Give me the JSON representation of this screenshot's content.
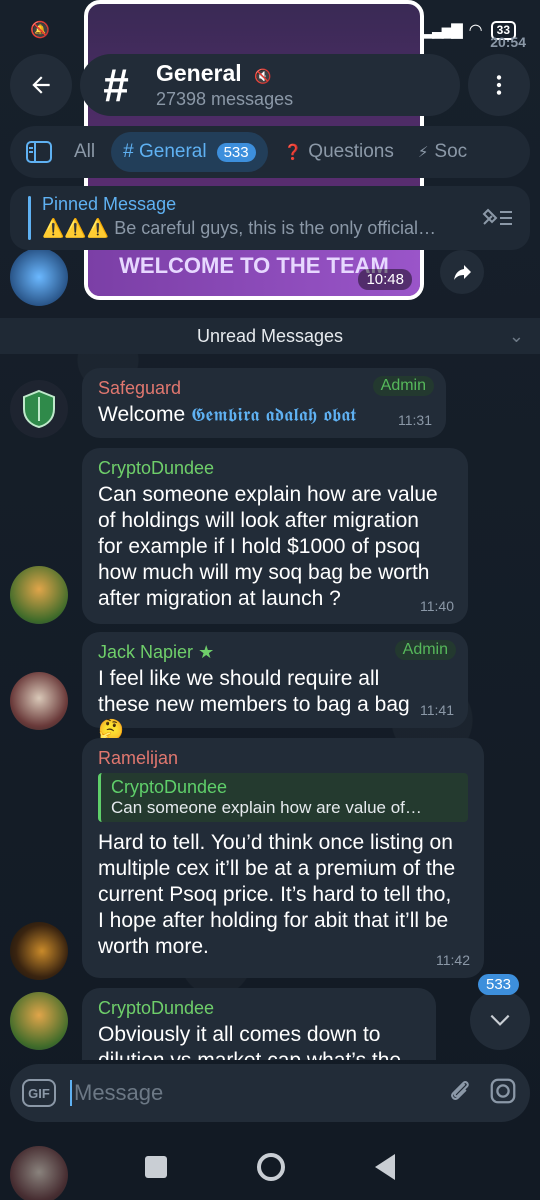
{
  "status_bar": {
    "time": "20:54",
    "battery": "33"
  },
  "header": {
    "title": "General",
    "subtitle": "27398 messages"
  },
  "tabs": [
    {
      "label": "All"
    },
    {
      "label": "# General",
      "badge": "533"
    },
    {
      "label": "Questions",
      "icon": "❓"
    },
    {
      "label": "Soc",
      "icon": "⚡"
    }
  ],
  "pinned": {
    "label": "Pinned Message",
    "text": "⚠️⚠️⚠️ Be careful guys, this is the only official…"
  },
  "media": {
    "banner": "WELCOME TO THE TEAM",
    "time": "10:48"
  },
  "unread_label": "Unread Messages",
  "messages": [
    {
      "name": "Safeguard",
      "role": "Admin",
      "text": "Welcome ",
      "text_styled": "𝕲𝖊𝖒𝖇𝖎𝖗𝖆 𝖆𝖉𝖆𝖑𝖆𝖍 𝖔𝖇𝖆𝖙",
      "time": "11:31"
    },
    {
      "name": "CryptoDundee",
      "text": "Can someone explain how are value of holdings will look after migration for example if I hold $1000 of psoq how much will my soq bag be worth after migration at launch ?",
      "time": "11:40"
    },
    {
      "name": "Jack Napier",
      "role": "Admin",
      "text": "I feel like we should require all these new members to bag a bag 🤔",
      "time": "11:41"
    },
    {
      "name": "Ramelijan",
      "reply_name": "CryptoDundee",
      "reply_text": "Can someone explain how are value of…",
      "text": "Hard to tell. You’d think once listing on multiple cex it’ll be at a premium of the current Psoq price. It’s hard to tell tho, I hope after holding for abit that it’ll be worth more.",
      "time": "11:42"
    },
    {
      "name": "CryptoDundee",
      "text": "Obviously it all comes down to dilution vs market cap what’s the"
    }
  ],
  "scroll_badge": "533",
  "composer": {
    "placeholder": "Message",
    "gif_label": "GIF"
  },
  "colors": {
    "accent": "#5fb1f2",
    "admin": "#56b85b",
    "bubble": "#222c38"
  }
}
